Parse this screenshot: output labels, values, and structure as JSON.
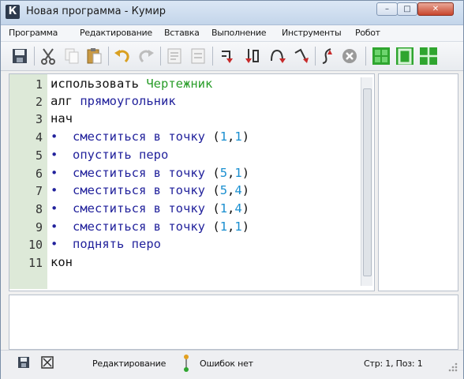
{
  "window": {
    "title": "Новая программа - Кумир",
    "icon_letter": "К"
  },
  "menu": [
    "Программа",
    "Редактирование",
    "Вставка",
    "Выполнение",
    "Инструменты",
    "Робот"
  ],
  "editor": {
    "line_numbers": [
      "1",
      "2",
      "3",
      "4",
      "5",
      "6",
      "7",
      "8",
      "9",
      "10",
      "11"
    ],
    "tokens": {
      "use": "использовать",
      "module": "Чертежник",
      "alg": "алг",
      "alg_name": "прямоугольник",
      "begin": "нач",
      "end": "кон",
      "move": "сместиться в точку",
      "pen_down": "опустить перо",
      "pen_up": "поднять перо",
      "bullet": "•",
      "open": "(",
      "comma": ",",
      "close": ")"
    },
    "coords": [
      {
        "x": "1",
        "y": "1"
      },
      {
        "x": "5",
        "y": "1"
      },
      {
        "x": "5",
        "y": "4"
      },
      {
        "x": "1",
        "y": "4"
      },
      {
        "x": "1",
        "y": "1"
      }
    ]
  },
  "status": {
    "mode": "Редактирование",
    "errors": "Ошибок нет",
    "position": "Стр: 1, Поз: 1"
  },
  "colors": {
    "action": "#22229c",
    "number": "#1a8fd0",
    "module": "#2a9d2a",
    "gutter": "#dde9d8",
    "robot_green": "#2fa52f"
  },
  "icons": {
    "toolbar": [
      "save-icon",
      "cut-icon",
      "copy-icon",
      "paste-icon",
      "undo-icon",
      "redo-icon",
      "comment-icon",
      "uncomment-icon",
      "run-icon",
      "step-icon",
      "step-into-icon",
      "step-out-icon",
      "step-back-icon",
      "stop-icon",
      "robot-window-icon",
      "draw-window-icon",
      "grid-icon"
    ],
    "status": [
      "save-output-icon",
      "clear-output-icon",
      "compile-status-icon"
    ]
  }
}
